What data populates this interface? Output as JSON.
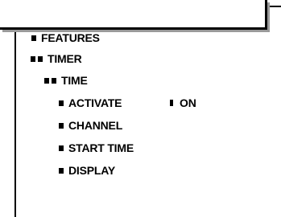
{
  "menu": {
    "features_label": "FEATURES",
    "timer_label": "TIMER",
    "time_label": "TIME",
    "activate_label": "ACTIVATE",
    "activate_value": "ON",
    "channel_label": "CHANNEL",
    "start_time_label": "START TIME",
    "display_label": "DISPLAY"
  },
  "colors": {
    "background": "#ffffff",
    "text": "#000000",
    "shadow": "#9a9a9a"
  },
  "icons": [
    "square-bullet-icon",
    "double-square-bullet-icon",
    "selected-value-marker-icon"
  ]
}
